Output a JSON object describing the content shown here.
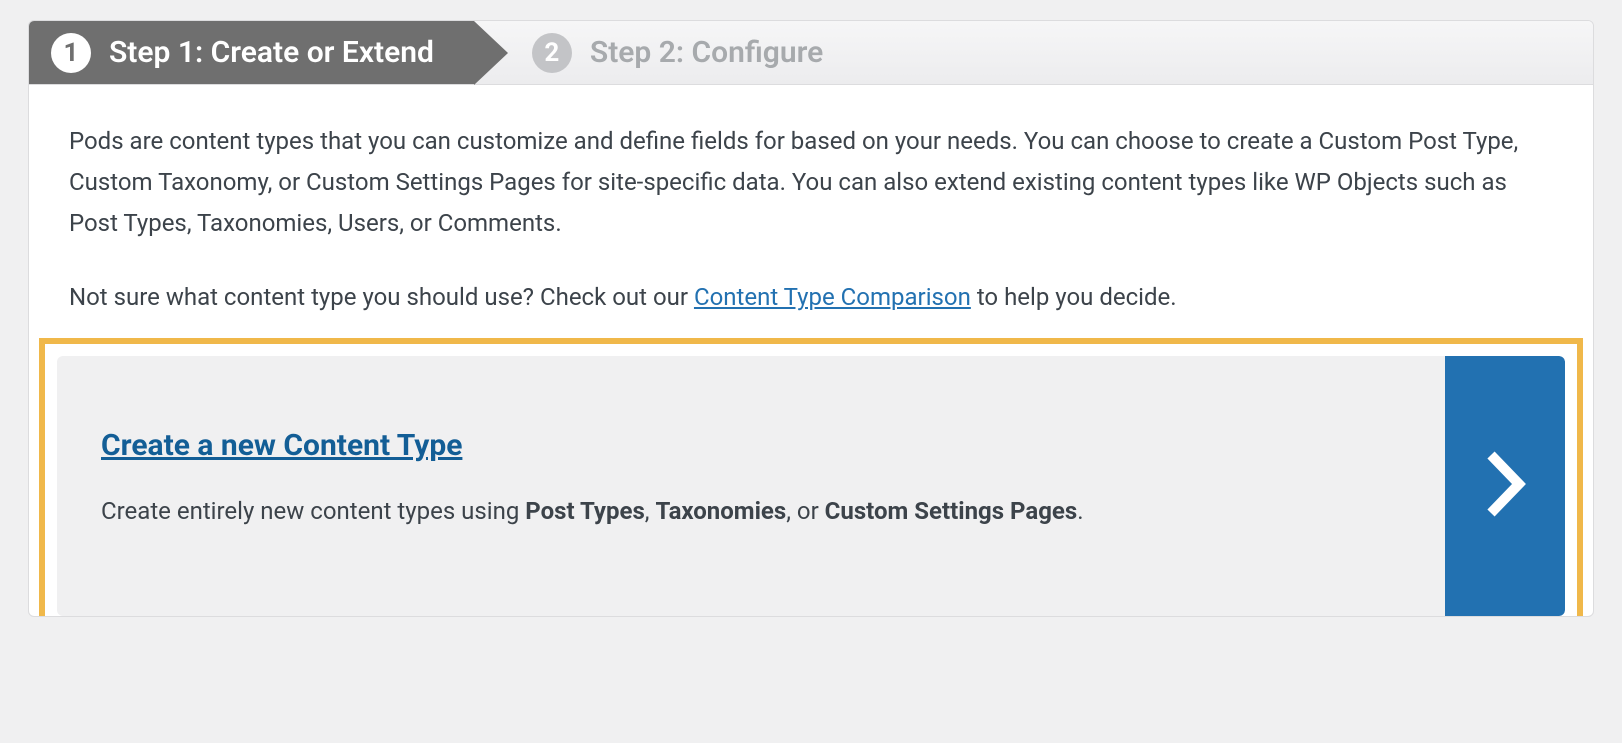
{
  "steps": {
    "one": {
      "num": "1",
      "label": "Step 1: Create or Extend"
    },
    "two": {
      "num": "2",
      "label": "Step 2: Configure"
    }
  },
  "intro": {
    "p1": "Pods are content types that you can customize and define fields for based on your needs. You can choose to create a Custom Post Type, Custom Taxonomy, or Custom Settings Pages for site-specific data. You can also extend existing content types like WP Objects such as Post Types, Taxonomies, Users, or Comments.",
    "p2_before": "Not sure what content type you should use? Check out our ",
    "p2_link": "Content Type Comparison",
    "p2_after": " to help you decide."
  },
  "option": {
    "title": "Create a new Content Type",
    "desc_before": "Create entirely new content types using ",
    "b1": "Post Types",
    "sep1": ", ",
    "b2": "Taxonomies",
    "sep2": ", or ",
    "b3": "Custom Settings Pages",
    "desc_after": "."
  }
}
